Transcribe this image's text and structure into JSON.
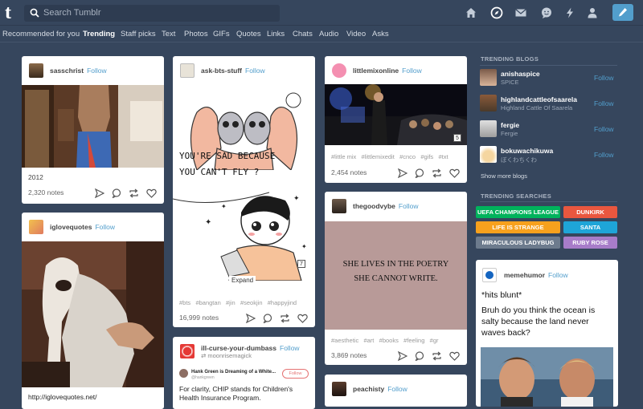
{
  "topbar": {
    "logo": "t",
    "search_placeholder": "Search Tumblr",
    "icons": [
      "home-icon",
      "explore-icon",
      "mail-icon",
      "messaging-icon",
      "activity-icon",
      "account-icon",
      "compose-icon"
    ],
    "compose_color": "#529ecc"
  },
  "subnav": {
    "items": [
      "Recommended for you",
      "Trending",
      "Staff picks",
      "Text",
      "Photos",
      "GIFs",
      "Quotes",
      "Links",
      "Chats",
      "Audio",
      "Video",
      "Asks"
    ],
    "active": "Trending"
  },
  "posts": {
    "sasschrist": {
      "name": "sasschrist",
      "follow": "Follow",
      "caption": "2012",
      "notes": "2,320 notes"
    },
    "iglovequotes": {
      "name": "iglovequotes",
      "follow": "Follow",
      "link": "http://iglovequotes.net/"
    },
    "askbts": {
      "name": "ask-bts-stuff",
      "follow": "Follow",
      "comic_line1": "YOU'RE SAD BECAUSE",
      "comic_line2": "YOU CAN'T FLY ?",
      "expand": "Expand",
      "badge": "7",
      "tags": [
        "#bts",
        "#bangtan",
        "#jin",
        "#seokjin",
        "#happyjind"
      ],
      "notes": "16,999 notes"
    },
    "illcurse": {
      "name": "ill-curse-your-dumbass",
      "follow": "Follow",
      "reblog_from": "moonrisemagick",
      "embed_name": "Hank Green is Dreaming of a White...",
      "embed_handle": "@hankgreen",
      "embed_follow": "Follow",
      "text": "For clarity, CHIP stands for Children's Health Insurance Program."
    },
    "littlemix": {
      "name": "littlemixonline",
      "follow": "Follow",
      "badge": "5",
      "tags": [
        "#little mix",
        "#littlemixedit",
        "#cnco",
        "#gifs",
        "#txt"
      ],
      "notes": "2,454 notes"
    },
    "goodvybe": {
      "name": "thegoodvybe",
      "follow": "Follow",
      "quote_line1": "SHE LIVES IN THE POETRY",
      "quote_line2": "SHE CANNOT WRITE.",
      "tags": [
        "#aesthetic",
        "#art",
        "#books",
        "#feeling",
        "#gr"
      ],
      "notes": "3,869 notes"
    },
    "peachisty": {
      "name": "peachisty",
      "follow": "Follow"
    },
    "memehumor": {
      "name": "memehumor",
      "follow": "Follow",
      "line1": "*hits blunt*",
      "line2": "Bruh do you think the ocean is salty because the land never waves back?"
    }
  },
  "sidebar": {
    "trending_blogs_title": "TRENDING BLOGS",
    "blogs": [
      {
        "name": "anishaspice",
        "sub": "SPICE",
        "follow": "Follow"
      },
      {
        "name": "highlandcattleofsaarela",
        "sub": "Highland Cattle Of Saarela",
        "follow": "Follow"
      },
      {
        "name": "fergie",
        "sub": "Fergie",
        "follow": "Follow"
      },
      {
        "name": "bokuwachikuwa",
        "sub": "ぼくわちくわ",
        "follow": "Follow"
      }
    ],
    "show_more": "Show more blogs",
    "trending_searches_title": "TRENDING SEARCHES",
    "searches": [
      {
        "label": "UEFA CHAMPIONS LEAGUE",
        "color": "#00b35c"
      },
      {
        "label": "DUNKIRK",
        "color": "#e9573f"
      },
      {
        "label": "LIFE IS STRANGE",
        "color": "#f7a11d"
      },
      {
        "label": "SANTA",
        "color": "#1ea5d8"
      },
      {
        "label": "MIRACULOUS LADYBUG",
        "color": "#6d7b8d"
      },
      {
        "label": "RUBY ROSE",
        "color": "#a77cc9"
      }
    ]
  }
}
